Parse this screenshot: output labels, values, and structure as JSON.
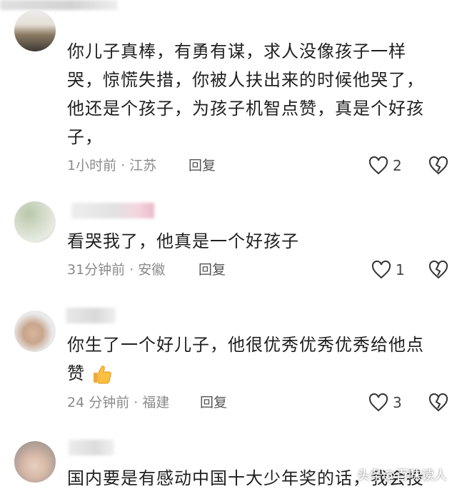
{
  "comments": [
    {
      "text_lines": [
        "你儿子真棒，有勇有谋，求人没像孩子一样",
        "哭，惊慌失措，你被人扶出来的时候他哭了，",
        "他还是个孩子，为孩子机智点赞，真是个好孩",
        "子，"
      ],
      "meta": "1小时前 · 江苏",
      "reply_label": "回复",
      "likes": "2"
    },
    {
      "text_lines": [
        "看哭我了，他真是一个好孩子"
      ],
      "meta": "31分钟前 · 安徽",
      "reply_label": "回复",
      "likes": "1"
    },
    {
      "text_lines": [
        "你生了一个好儿子，他很优秀优秀优秀给他点",
        "赞"
      ],
      "meta": "24 分钟前 · 福建",
      "reply_label": "回复",
      "likes": "3"
    },
    {
      "text_lines": [
        "国内要是有感动中国十大少年奖的话，我会投"
      ],
      "meta": "",
      "reply_label": "",
      "likes": ""
    }
  ],
  "watermark": "头条@百味读人",
  "icons": {
    "like": "heart-outline-icon",
    "dislike": "broken-heart-icon",
    "thumbs_up_emoji": "thumbs-up-emoji"
  },
  "colors": {
    "text": "#1f1f1f",
    "meta": "#8a8a8a",
    "icon": "#333333"
  }
}
